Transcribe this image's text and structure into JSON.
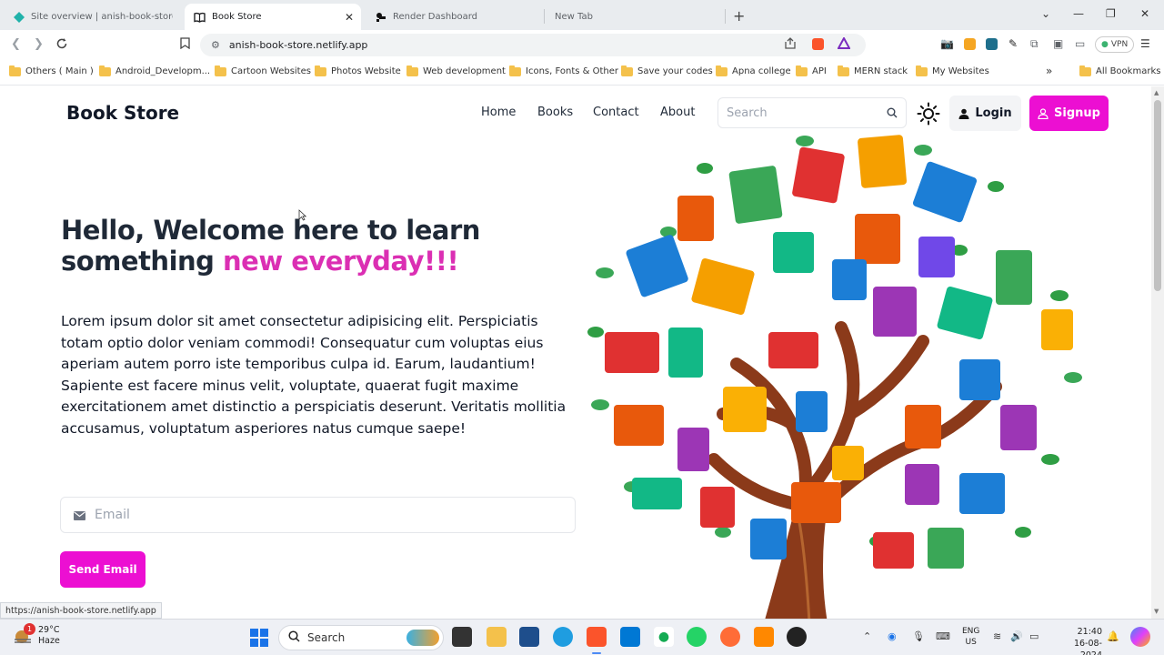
{
  "browser": {
    "tabs": [
      {
        "title": "Site overview | anish-book-store | N",
        "active": false,
        "icon": "netlify-icon"
      },
      {
        "title": "Book Store",
        "active": true,
        "icon": "book-icon"
      },
      {
        "title": "Render Dashboard",
        "active": false,
        "icon": "render-icon"
      },
      {
        "title": "New Tab",
        "active": false,
        "icon": "none"
      }
    ],
    "url": "anish-book-store.netlify.app",
    "vpn_label": "VPN",
    "bookmarks": [
      "Others ( Main )",
      "Android_Developm...",
      "Cartoon Websites",
      "Photos Website",
      "Web development",
      "Icons, Fonts & Other",
      "Save your codes",
      "Apna college",
      "API",
      "MERN stack",
      "My Websites"
    ],
    "all_bookmarks": "All Bookmarks",
    "status_url": "https://anish-book-store.netlify.app"
  },
  "site": {
    "brand": "Book Store",
    "nav": [
      "Home",
      "Books",
      "Contact",
      "About"
    ],
    "search_placeholder": "Search",
    "login_label": "Login",
    "signup_label": "Signup",
    "hero": {
      "title_part1": "Hello, Welcome here to learn something ",
      "title_accent": "new everyday!!!",
      "body": "Lorem ipsum dolor sit amet consectetur adipisicing elit. Perspiciatis totam optio dolor veniam commodi! Consequatur cum voluptas eius aperiam autem porro iste temporibus culpa id. Earum, laudantium! Sapiente est facere minus velit, voluptate, quaerat fugit maxime exercitationem amet distinctio a perspiciatis deserunt. Veritatis mollitia accusamus, voluptatum asperiores natus cumque saepe!",
      "email_placeholder": "Email",
      "send_label": "Send Email"
    },
    "colors": {
      "accent": "#ec0fd2",
      "accent_text": "#db2fb3"
    }
  },
  "taskbar": {
    "weather_temp": "29°C",
    "weather_desc": "Haze",
    "weather_badge": "1",
    "search_label": "Search",
    "lang_top": "ENG",
    "lang_bottom": "US",
    "time": "21:40",
    "date": "16-08-2024"
  }
}
